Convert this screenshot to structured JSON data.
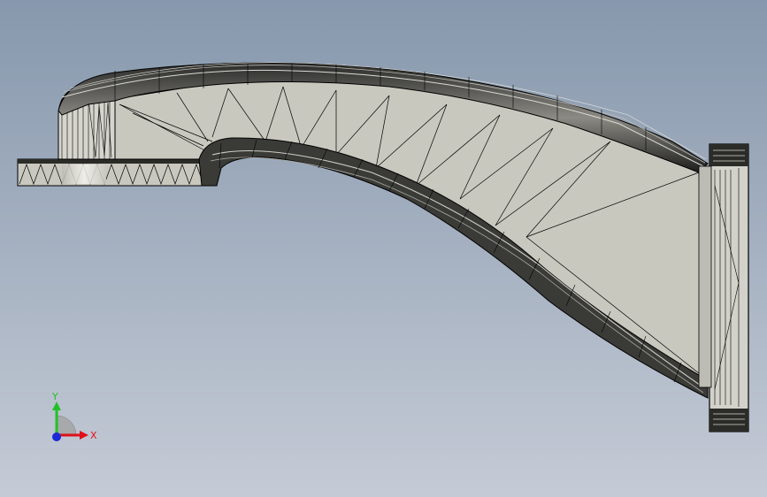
{
  "viewport": {
    "background_top": "#8798ad",
    "background_bottom": "#c5cbd6"
  },
  "model": {
    "description_icon": "bracket-part-mesh",
    "face_color": "#c9c8bf",
    "edge_color": "#000000"
  },
  "triad": {
    "x_label": "X",
    "y_label": "Y",
    "x_color": "#e0101a",
    "y_color": "#22c02a",
    "z_color": "#1b2ad6"
  }
}
